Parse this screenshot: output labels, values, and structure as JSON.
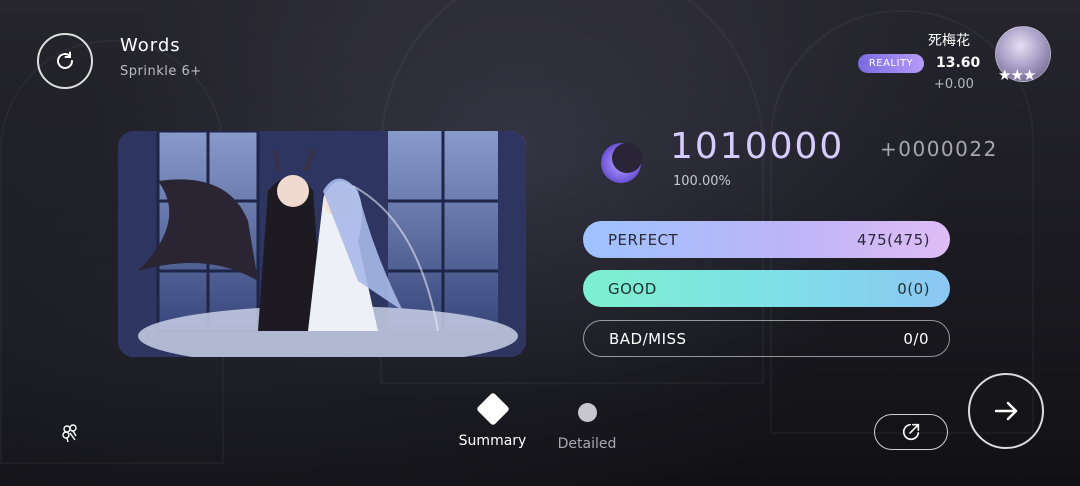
{
  "song": {
    "title": "Words",
    "level": "Sprinkle 6+"
  },
  "result": {
    "score": "1010000",
    "score_delta": "+0000022",
    "accuracy": "100.00%",
    "judgements": [
      {
        "label": "PERFECT",
        "value": "475(475)"
      },
      {
        "label": "GOOD",
        "value": "0(0)"
      },
      {
        "label": "BAD/MISS",
        "value": "0/0"
      }
    ]
  },
  "player": {
    "name": "死梅花",
    "badge": "REALITY",
    "rks": "13.60",
    "rks_delta": "+0.00",
    "stars": "★★★"
  },
  "tabs": [
    {
      "label": "Summary",
      "active": true
    },
    {
      "label": "Detailed",
      "active": false
    }
  ],
  "icons": {
    "retry": "retry-icon",
    "next": "arrow-right-icon",
    "share": "share-icon",
    "score": "crescent-moon-icon",
    "flower": "flower-icon"
  },
  "colors": {
    "perfect_gradient": [
      "#9ec3ff",
      "#dfbcf5"
    ],
    "good_gradient": [
      "#7df0cf",
      "#8cc6f3"
    ],
    "score_text": "#d8cbff",
    "badge": "#9a85f0"
  }
}
